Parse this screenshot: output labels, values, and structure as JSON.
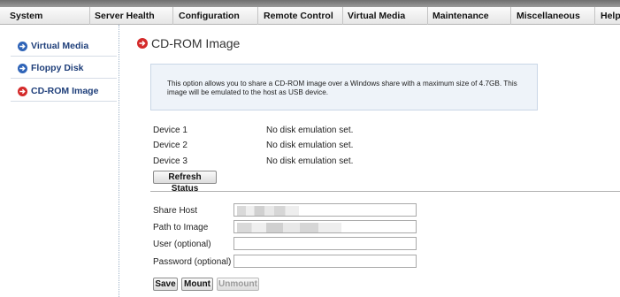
{
  "menu": {
    "items": [
      "System",
      "Server Health",
      "Configuration",
      "Remote Control",
      "Virtual Media",
      "Maintenance",
      "Miscellaneous",
      "Help"
    ]
  },
  "sidebar": {
    "items": [
      {
        "label": "Virtual Media",
        "icon": "circle-arrow-icon",
        "color": "#2f64b8"
      },
      {
        "label": "Floppy Disk",
        "icon": "circle-arrow-icon",
        "color": "#2f64b8"
      },
      {
        "label": "CD-ROM Image",
        "icon": "circle-arrow-icon",
        "color": "#d42a2a",
        "active": true
      }
    ]
  },
  "main": {
    "title": "CD-ROM Image",
    "title_icon_color": "#d42a2a",
    "info": "This option allows you to share a CD-ROM image over a Windows share with a maximum size of 4.7GB. This image will be emulated to the host as USB device.",
    "devices": [
      {
        "label": "Device 1",
        "status": "No disk emulation set."
      },
      {
        "label": "Device 2",
        "status": "No disk emulation set."
      },
      {
        "label": "Device 3",
        "status": "No disk emulation set."
      }
    ],
    "refresh_label": "Refresh Status",
    "form": {
      "share_host_label": "Share Host",
      "share_host_value": "",
      "path_label": "Path to Image",
      "path_value": "",
      "user_label": "User (optional)",
      "user_value": "",
      "password_label": "Password (optional)",
      "password_value": ""
    },
    "buttons": {
      "save": "Save",
      "mount": "Mount",
      "unmount": "Unmount"
    }
  }
}
